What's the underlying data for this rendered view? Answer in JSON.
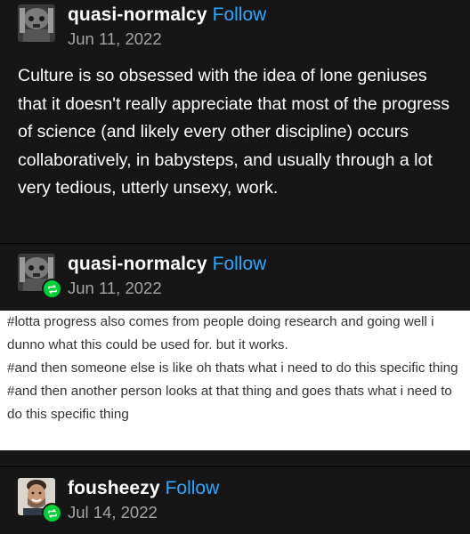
{
  "posts": [
    {
      "username": "quasi-normalcy",
      "follow_label": "Follow",
      "date": "Jun 11, 2022",
      "avatar_icon": "avatar-image",
      "body": "Culture is so obsessed with the idea of lone geniuses that it doesn't really appreciate that most of the progress of science (and likely every other discipline) occurs collaboratively, in babysteps, and usually through a lot very tedious, utterly unsexy, work."
    },
    {
      "username": "quasi-normalcy",
      "follow_label": "Follow",
      "date": "Jun 11, 2022",
      "avatar_icon": "avatar-image",
      "reblog_icon": "reblog-icon",
      "tags": [
        "#lotta progress also comes from people doing research and going well i dunno what this could be used for. but it works.",
        "#and then someone else is like oh thats what i need to do this specific thing",
        "#and then another person looks at that thing and goes thats what i need to do this specific thing"
      ]
    },
    {
      "username": "fousheezy",
      "follow_label": "Follow",
      "date": "Jul 14, 2022",
      "avatar_icon": "avatar-image",
      "reblog_icon": "reblog-icon"
    }
  ],
  "colors": {
    "background": "#161616",
    "separator": "#000000",
    "username": "#ffffff",
    "follow": "#2ea7ff",
    "date": "#a4a4a4",
    "tags_background": "#ffffff",
    "tags_text": "#333333",
    "reblog_badge": "#00cf35"
  }
}
